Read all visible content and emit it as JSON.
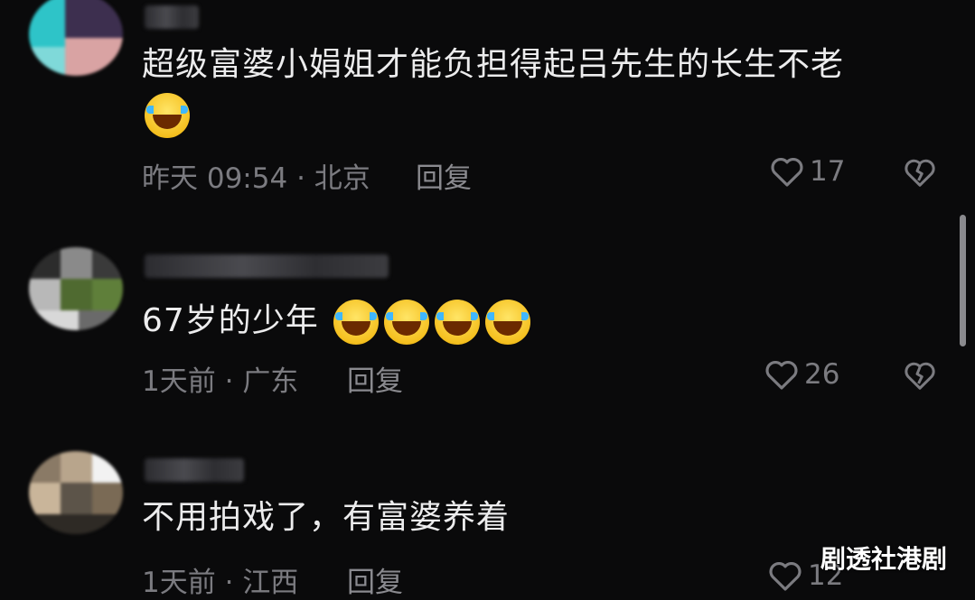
{
  "comments": [
    {
      "text": "超级富婆小娟姐才能负担得起吕先生的长生不老",
      "emojis": [
        "😂"
      ],
      "time": "昨天 09:54",
      "location": "北京",
      "reply_label": "回复",
      "likes": "17"
    },
    {
      "text": "67岁的少年",
      "emojis": [
        "🤣",
        "🤣",
        "🤣",
        "🤣"
      ],
      "time": "1天前",
      "location": "广东",
      "reply_label": "回复",
      "likes": "26"
    },
    {
      "text": "不用拍戏了，有富婆养着",
      "emojis": [],
      "time": "1天前",
      "location": "江西",
      "reply_label": "回复",
      "likes": "12"
    }
  ],
  "meta_separator": "·",
  "watermark": "剧透社港剧",
  "icons": {
    "like": "heart-outline-icon",
    "dislike": "broken-heart-icon"
  },
  "colors": {
    "background": "#0a0a0b",
    "comment_text": "#ececed",
    "meta_text": "#7b7b80"
  }
}
